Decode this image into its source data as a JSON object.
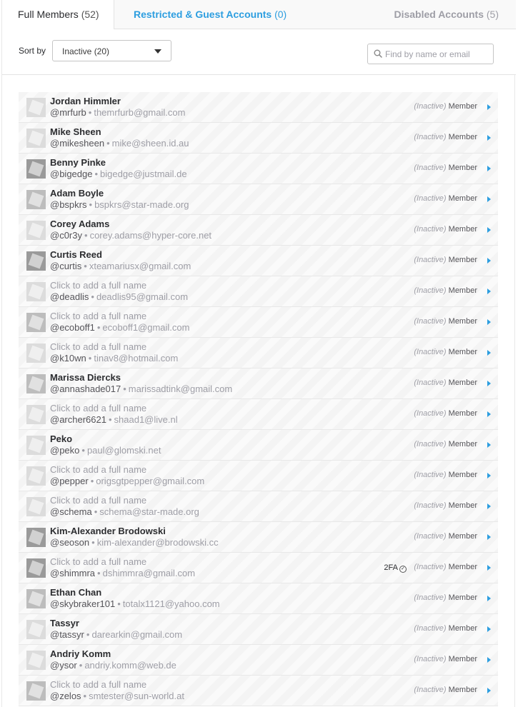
{
  "tabs": {
    "full": {
      "label": "Full Members",
      "count": "(52)"
    },
    "restricted": {
      "label": "Restricted & Guest Accounts",
      "count": "(0)"
    },
    "disabled": {
      "label": "Disabled Accounts",
      "count": "(5)"
    }
  },
  "toolbar": {
    "sort_label": "Sort by",
    "sort_value": "Inactive (20)",
    "search_placeholder": "Find by name or email"
  },
  "colors": {
    "accent": "#2d9ee0",
    "muted": "#9e9ea6",
    "text": "#2c2d30"
  },
  "members": [
    {
      "name": "Jordan Himmler",
      "name_set": true,
      "handle": "@mrfurb",
      "email": "themrfurb@gmail.com",
      "state": "(Inactive)",
      "role": "Member",
      "twofa": false
    },
    {
      "name": "Mike Sheen",
      "name_set": true,
      "handle": "@mikesheen",
      "email": "mike@sheen.id.au",
      "state": "(Inactive)",
      "role": "Member",
      "twofa": false
    },
    {
      "name": "Benny Pinke",
      "name_set": true,
      "handle": "@bigedge",
      "email": "bigedge@justmail.de",
      "state": "(Inactive)",
      "role": "Member",
      "twofa": false
    },
    {
      "name": "Adam Boyle",
      "name_set": true,
      "handle": "@bspkrs",
      "email": "bspkrs@star-made.org",
      "state": "(Inactive)",
      "role": "Member",
      "twofa": false
    },
    {
      "name": "Corey Adams",
      "name_set": true,
      "handle": "@c0r3y",
      "email": "corey.adams@hyper-core.net",
      "state": "(Inactive)",
      "role": "Member",
      "twofa": false
    },
    {
      "name": "Curtis Reed",
      "name_set": true,
      "handle": "@curtis",
      "email": "xteamariusx@gmail.com",
      "state": "(Inactive)",
      "role": "Member",
      "twofa": false
    },
    {
      "name": "Click to add a full name",
      "name_set": false,
      "handle": "@deadlis",
      "email": "deadlis95@gmail.com",
      "state": "(Inactive)",
      "role": "Member",
      "twofa": false
    },
    {
      "name": "Click to add a full name",
      "name_set": false,
      "handle": "@ecoboff1",
      "email": "ecoboff1@gmail.com",
      "state": "(Inactive)",
      "role": "Member",
      "twofa": false
    },
    {
      "name": "Click to add a full name",
      "name_set": false,
      "handle": "@k10wn",
      "email": "tinav8@hotmail.com",
      "state": "(Inactive)",
      "role": "Member",
      "twofa": false
    },
    {
      "name": "Marissa Diercks",
      "name_set": true,
      "handle": "@annashade017",
      "email": "marissadtink@gmail.com",
      "state": "(Inactive)",
      "role": "Member",
      "twofa": false
    },
    {
      "name": "Click to add a full name",
      "name_set": false,
      "handle": "@archer6621",
      "email": "shaad1@live.nl",
      "state": "(Inactive)",
      "role": "Member",
      "twofa": false
    },
    {
      "name": "Peko",
      "name_set": true,
      "handle": "@peko",
      "email": "paul@glomski.net",
      "state": "(Inactive)",
      "role": "Member",
      "twofa": false
    },
    {
      "name": "Click to add a full name",
      "name_set": false,
      "handle": "@pepper",
      "email": "origsgtpepper@gmail.com",
      "state": "(Inactive)",
      "role": "Member",
      "twofa": false
    },
    {
      "name": "Click to add a full name",
      "name_set": false,
      "handle": "@schema",
      "email": "schema@star-made.org",
      "state": "(Inactive)",
      "role": "Member",
      "twofa": false
    },
    {
      "name": "Kim-Alexander Brodowski",
      "name_set": true,
      "handle": "@seoson",
      "email": "kim-alexander@brodowski.cc",
      "state": "(Inactive)",
      "role": "Member",
      "twofa": false
    },
    {
      "name": "Click to add a full name",
      "name_set": false,
      "handle": "@shimmra",
      "email": "dshimmra@gmail.com",
      "state": "(Inactive)",
      "role": "Member",
      "twofa": true,
      "twofa_label": "2FA"
    },
    {
      "name": "Ethan Chan",
      "name_set": true,
      "handle": "@skybraker101",
      "email": "totalx1121@yahoo.com",
      "state": "(Inactive)",
      "role": "Member",
      "twofa": false
    },
    {
      "name": "Tassyr",
      "name_set": true,
      "handle": "@tassyr",
      "email": "darearkin@gmail.com",
      "state": "(Inactive)",
      "role": "Member",
      "twofa": false
    },
    {
      "name": "Andriy Komm",
      "name_set": true,
      "handle": "@ysor",
      "email": "andriy.komm@web.de",
      "state": "(Inactive)",
      "role": "Member",
      "twofa": false
    },
    {
      "name": "Click to add a full name",
      "name_set": false,
      "handle": "@zelos",
      "email": "smtester@sun-world.at",
      "state": "(Inactive)",
      "role": "Member",
      "twofa": false
    }
  ]
}
